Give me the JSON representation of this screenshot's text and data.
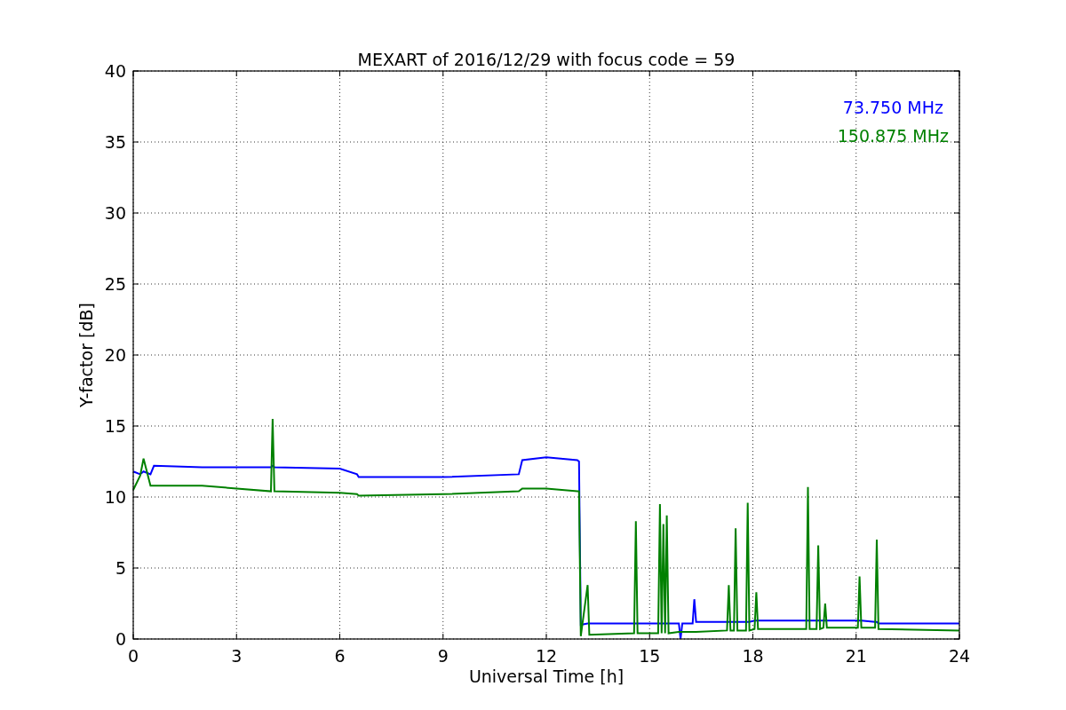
{
  "figure": {
    "chart_data": {
      "type": "line",
      "title": "MEXART of 2016/12/29 with focus code = 59",
      "xlabel": "Universal Time [h]",
      "ylabel": "Y-factor [dB]",
      "x": [
        0,
        0.2,
        0.3,
        0.5,
        0.6,
        2,
        4,
        4.05,
        4.1,
        6,
        6.5,
        6.55,
        9,
        11.2,
        11.3,
        12,
        12.9,
        12.95,
        13,
        13.2,
        13.25,
        14.55,
        14.6,
        14.65,
        15.25,
        15.3,
        15.35,
        15.4,
        15.45,
        15.5,
        15.55,
        15.85,
        15.9,
        15.95,
        16.25,
        16.3,
        16.35,
        17.25,
        17.3,
        17.35,
        17.45,
        17.5,
        17.55,
        17.8,
        17.85,
        17.9,
        18.05,
        18.1,
        18.15,
        19.55,
        19.6,
        19.65,
        19.85,
        19.9,
        19.95,
        20.05,
        20.1,
        20.15,
        21.05,
        21.1,
        21.15,
        21.55,
        21.6,
        21.65,
        24
      ],
      "series": [
        {
          "name": "73.750 MHz",
          "color": "#0000ff",
          "values": [
            11.8,
            11.6,
            11.8,
            11.6,
            12.2,
            12.1,
            12.1,
            12.2,
            12.1,
            12.0,
            11.6,
            11.4,
            11.4,
            11.6,
            12.6,
            12.8,
            12.6,
            12.5,
            1.0,
            1.1,
            1.1,
            1.1,
            1.1,
            1.1,
            1.1,
            1.1,
            1.1,
            1.1,
            1.1,
            1.1,
            1.1,
            1.1,
            0,
            1.1,
            1.1,
            2.8,
            1.2,
            1.2,
            1.2,
            1.2,
            1.2,
            1.2,
            1.2,
            1.2,
            1.2,
            1.2,
            1.3,
            1.3,
            1.3,
            1.3,
            1.3,
            1.3,
            1.3,
            1.3,
            1.3,
            1.3,
            1.3,
            1.3,
            1.3,
            1.3,
            1.3,
            1.2,
            1.2,
            1.1,
            1.1
          ]
        },
        {
          "name": "150.875 MHz",
          "color": "#008000",
          "values": [
            10.5,
            11.5,
            12.7,
            10.8,
            10.8,
            10.8,
            10.4,
            15.5,
            10.4,
            10.3,
            10.2,
            10.1,
            10.2,
            10.4,
            10.6,
            10.6,
            10.4,
            10.4,
            0.2,
            3.8,
            0.3,
            0.4,
            8.3,
            0.4,
            0.4,
            9.5,
            0.4,
            8.1,
            0.4,
            8.7,
            0.4,
            0.5,
            0.5,
            0.5,
            0.5,
            0.5,
            0.5,
            0.6,
            3.8,
            0.6,
            0.6,
            7.8,
            0.6,
            0.6,
            9.6,
            0.6,
            0.7,
            3.3,
            0.7,
            0.7,
            10.7,
            0.7,
            0.7,
            6.6,
            0.7,
            0.8,
            2.5,
            0.8,
            0.8,
            4.4,
            0.8,
            0.8,
            7.0,
            0.7,
            0.6
          ]
        }
      ],
      "grid": true,
      "xlim": [
        0,
        24
      ],
      "ylim": [
        0,
        40
      ],
      "xticks": [
        0,
        3,
        6,
        9,
        12,
        15,
        18,
        21,
        24
      ],
      "yticks": [
        0,
        5,
        10,
        15,
        20,
        25,
        30,
        35,
        40
      ]
    }
  }
}
